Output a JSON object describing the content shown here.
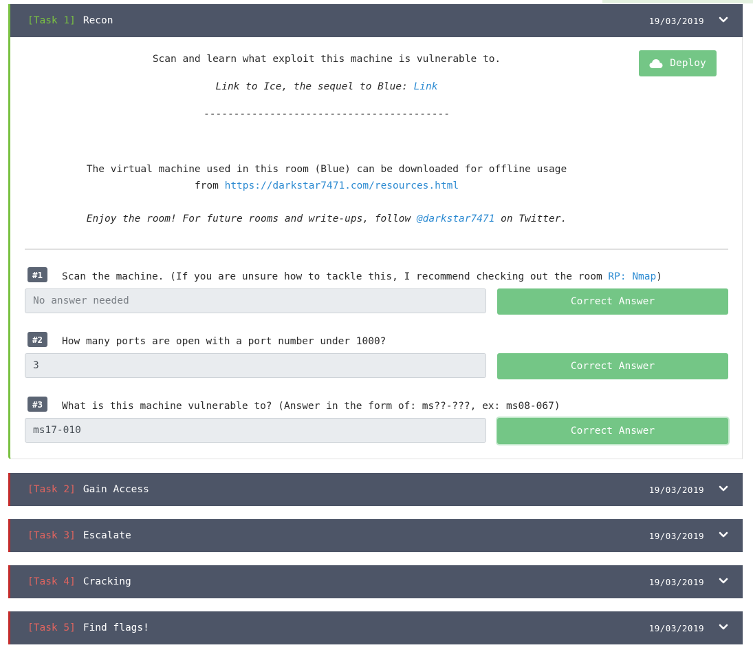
{
  "colors": {
    "header_bg": "#4d5567",
    "done_accent": "#7ac142",
    "locked_accent": "#c22b2b",
    "locked_tag": "#e0645f",
    "success_button": "#74c686",
    "link": "#2d8bd2"
  },
  "task1": {
    "tag": "[Task 1]",
    "title": "Recon",
    "date": "19/03/2019",
    "expand_icon": "chevron-down-icon",
    "deploy": {
      "icon": "cloud-icon",
      "label": "Deploy"
    },
    "intro": "Scan and learn what exploit this machine is vulnerable to.",
    "ice_text": "Link to Ice, the sequel to Blue: ",
    "ice_link": "Link",
    "separator": "-----------------------------------------",
    "vm_line1": "The virtual machine used in this room (Blue) can be downloaded for offline usage",
    "vm_line2_prefix": "from ",
    "vm_link": "https://darkstar7471.com/resources.html",
    "enjoy_prefix": "Enjoy the room! For future rooms and write-ups, follow ",
    "enjoy_link": "@darkstar7471",
    "enjoy_suffix": " on Twitter.",
    "questions": [
      {
        "num": "#1",
        "text": "Scan the machine. (If you are unsure how to tackle this, I recommend checking out the room ",
        "link": "RP: Nmap",
        "text_after": ")",
        "answer": "",
        "placeholder": "No answer needed",
        "button": "Correct Answer"
      },
      {
        "num": "#2",
        "text": "How many ports are open with a port number under 1000?",
        "answer": "3",
        "placeholder": "",
        "button": "Correct Answer"
      },
      {
        "num": "#3",
        "text": "What is this machine vulnerable to? (Answer in the form of: ms??-???, ex: ms08-067)",
        "answer": "ms17-010",
        "placeholder": "",
        "button": "Correct Answer"
      }
    ]
  },
  "tasks": [
    {
      "tag": "[Task 2]",
      "title": "Gain Access",
      "date": "19/03/2019"
    },
    {
      "tag": "[Task 3]",
      "title": "Escalate",
      "date": "19/03/2019"
    },
    {
      "tag": "[Task 4]",
      "title": "Cracking",
      "date": "19/03/2019"
    },
    {
      "tag": "[Task 5]",
      "title": "Find flags!",
      "date": "19/03/2019"
    }
  ]
}
